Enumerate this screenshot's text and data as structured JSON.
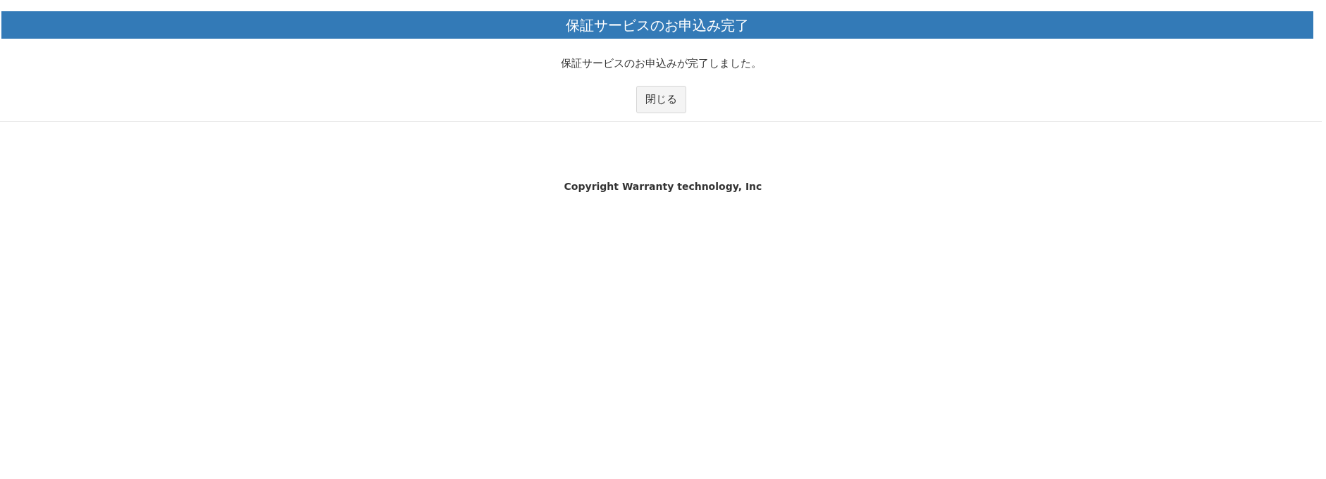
{
  "header": {
    "title": "保証サービスのお申込み完了"
  },
  "message": "保証サービスのお申込みが完了しました。",
  "buttons": [
    "閉じる"
  ],
  "footer": {
    "copyright": "Copyright Warranty technology, Inc"
  }
}
